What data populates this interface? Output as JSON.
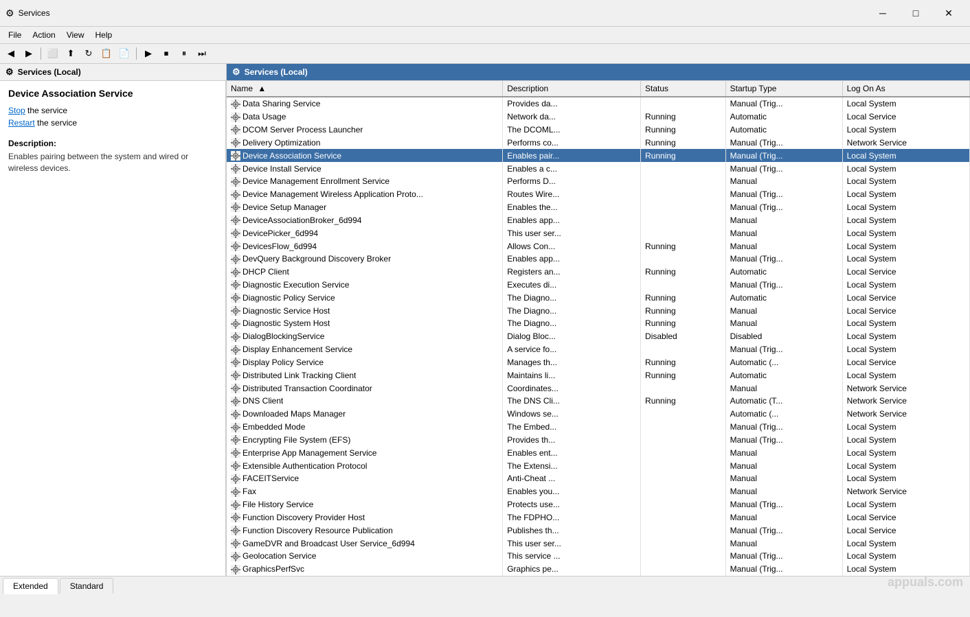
{
  "window": {
    "title": "Services",
    "icon": "⚙"
  },
  "titlebar": {
    "minimize": "─",
    "maximize": "□",
    "close": "✕"
  },
  "menu": {
    "items": [
      "File",
      "Action",
      "View",
      "Help"
    ]
  },
  "header": {
    "left_title": "Services (Local)",
    "right_title": "Services (Local)"
  },
  "left_panel": {
    "service_title": "Device Association Service",
    "stop_label": "Stop",
    "stop_suffix": " the service",
    "restart_label": "Restart",
    "restart_suffix": " the service",
    "desc_title": "Description:",
    "desc_text": "Enables pairing between the system and wired or wireless devices."
  },
  "table": {
    "columns": [
      "Name",
      "Description",
      "Status",
      "Startup Type",
      "Log On As"
    ],
    "sort_arrow": "▲",
    "services": [
      {
        "name": "Data Sharing Service",
        "desc": "Provides da...",
        "status": "",
        "startup": "Manual (Trig...",
        "logon": "Local System",
        "selected": false
      },
      {
        "name": "Data Usage",
        "desc": "Network da...",
        "status": "Running",
        "startup": "Automatic",
        "logon": "Local Service",
        "selected": false
      },
      {
        "name": "DCOM Server Process Launcher",
        "desc": "The DCOML...",
        "status": "Running",
        "startup": "Automatic",
        "logon": "Local System",
        "selected": false
      },
      {
        "name": "Delivery Optimization",
        "desc": "Performs co...",
        "status": "Running",
        "startup": "Manual (Trig...",
        "logon": "Network Service",
        "selected": false
      },
      {
        "name": "Device Association Service",
        "desc": "Enables pair...",
        "status": "Running",
        "startup": "Manual (Trig...",
        "logon": "Local System",
        "selected": true
      },
      {
        "name": "Device Install Service",
        "desc": "Enables a c...",
        "status": "",
        "startup": "Manual (Trig...",
        "logon": "Local System",
        "selected": false
      },
      {
        "name": "Device Management Enrollment Service",
        "desc": "Performs D...",
        "status": "",
        "startup": "Manual",
        "logon": "Local System",
        "selected": false
      },
      {
        "name": "Device Management Wireless Application Proto...",
        "desc": "Routes Wire...",
        "status": "",
        "startup": "Manual (Trig...",
        "logon": "Local System",
        "selected": false
      },
      {
        "name": "Device Setup Manager",
        "desc": "Enables the...",
        "status": "",
        "startup": "Manual (Trig...",
        "logon": "Local System",
        "selected": false
      },
      {
        "name": "DeviceAssociationBroker_6d994",
        "desc": "Enables app...",
        "status": "",
        "startup": "Manual",
        "logon": "Local System",
        "selected": false
      },
      {
        "name": "DevicePicker_6d994",
        "desc": "This user ser...",
        "status": "",
        "startup": "Manual",
        "logon": "Local System",
        "selected": false
      },
      {
        "name": "DevicesFlow_6d994",
        "desc": "Allows Con...",
        "status": "Running",
        "startup": "Manual",
        "logon": "Local System",
        "selected": false
      },
      {
        "name": "DevQuery Background Discovery Broker",
        "desc": "Enables app...",
        "status": "",
        "startup": "Manual (Trig...",
        "logon": "Local System",
        "selected": false
      },
      {
        "name": "DHCP Client",
        "desc": "Registers an...",
        "status": "Running",
        "startup": "Automatic",
        "logon": "Local Service",
        "selected": false
      },
      {
        "name": "Diagnostic Execution Service",
        "desc": "Executes di...",
        "status": "",
        "startup": "Manual (Trig...",
        "logon": "Local System",
        "selected": false
      },
      {
        "name": "Diagnostic Policy Service",
        "desc": "The Diagno...",
        "status": "Running",
        "startup": "Automatic",
        "logon": "Local Service",
        "selected": false
      },
      {
        "name": "Diagnostic Service Host",
        "desc": "The Diagno...",
        "status": "Running",
        "startup": "Manual",
        "logon": "Local Service",
        "selected": false
      },
      {
        "name": "Diagnostic System Host",
        "desc": "The Diagno...",
        "status": "Running",
        "startup": "Manual",
        "logon": "Local System",
        "selected": false
      },
      {
        "name": "DialogBlockingService",
        "desc": "Dialog Bloc...",
        "status": "Disabled",
        "startup": "Disabled",
        "logon": "Local System",
        "selected": false
      },
      {
        "name": "Display Enhancement Service",
        "desc": "A service fo...",
        "status": "",
        "startup": "Manual (Trig...",
        "logon": "Local System",
        "selected": false
      },
      {
        "name": "Display Policy Service",
        "desc": "Manages th...",
        "status": "Running",
        "startup": "Automatic (...",
        "logon": "Local Service",
        "selected": false
      },
      {
        "name": "Distributed Link Tracking Client",
        "desc": "Maintains li...",
        "status": "Running",
        "startup": "Automatic",
        "logon": "Local System",
        "selected": false
      },
      {
        "name": "Distributed Transaction Coordinator",
        "desc": "Coordinates...",
        "status": "",
        "startup": "Manual",
        "logon": "Network Service",
        "selected": false
      },
      {
        "name": "DNS Client",
        "desc": "The DNS Cli...",
        "status": "Running",
        "startup": "Automatic (T...",
        "logon": "Network Service",
        "selected": false
      },
      {
        "name": "Downloaded Maps Manager",
        "desc": "Windows se...",
        "status": "",
        "startup": "Automatic (...",
        "logon": "Network Service",
        "selected": false
      },
      {
        "name": "Embedded Mode",
        "desc": "The Embed...",
        "status": "",
        "startup": "Manual (Trig...",
        "logon": "Local System",
        "selected": false
      },
      {
        "name": "Encrypting File System (EFS)",
        "desc": "Provides th...",
        "status": "",
        "startup": "Manual (Trig...",
        "logon": "Local System",
        "selected": false
      },
      {
        "name": "Enterprise App Management Service",
        "desc": "Enables ent...",
        "status": "",
        "startup": "Manual",
        "logon": "Local System",
        "selected": false
      },
      {
        "name": "Extensible Authentication Protocol",
        "desc": "The Extensi...",
        "status": "",
        "startup": "Manual",
        "logon": "Local System",
        "selected": false
      },
      {
        "name": "FACEITService",
        "desc": "Anti-Cheat ...",
        "status": "",
        "startup": "Manual",
        "logon": "Local System",
        "selected": false
      },
      {
        "name": "Fax",
        "desc": "Enables you...",
        "status": "",
        "startup": "Manual",
        "logon": "Network Service",
        "selected": false
      },
      {
        "name": "File History Service",
        "desc": "Protects use...",
        "status": "",
        "startup": "Manual (Trig...",
        "logon": "Local System",
        "selected": false
      },
      {
        "name": "Function Discovery Provider Host",
        "desc": "The FDPHO...",
        "status": "",
        "startup": "Manual",
        "logon": "Local Service",
        "selected": false
      },
      {
        "name": "Function Discovery Resource Publication",
        "desc": "Publishes th...",
        "status": "",
        "startup": "Manual (Trig...",
        "logon": "Local Service",
        "selected": false
      },
      {
        "name": "GameDVR and Broadcast User Service_6d994",
        "desc": "This user ser...",
        "status": "",
        "startup": "Manual",
        "logon": "Local System",
        "selected": false
      },
      {
        "name": "Geolocation Service",
        "desc": "This service ...",
        "status": "",
        "startup": "Manual (Trig...",
        "logon": "Local System",
        "selected": false
      },
      {
        "name": "GraphicsPerfSvc",
        "desc": "Graphics pe...",
        "status": "",
        "startup": "Manual (Trig...",
        "logon": "Local System",
        "selected": false
      }
    ]
  },
  "tabs": [
    "Extended",
    "Standard"
  ],
  "active_tab": "Extended",
  "colors": {
    "selected_bg": "#3b6ea5",
    "selected_text": "#ffffff",
    "header_bg": "#3b6ea5"
  }
}
